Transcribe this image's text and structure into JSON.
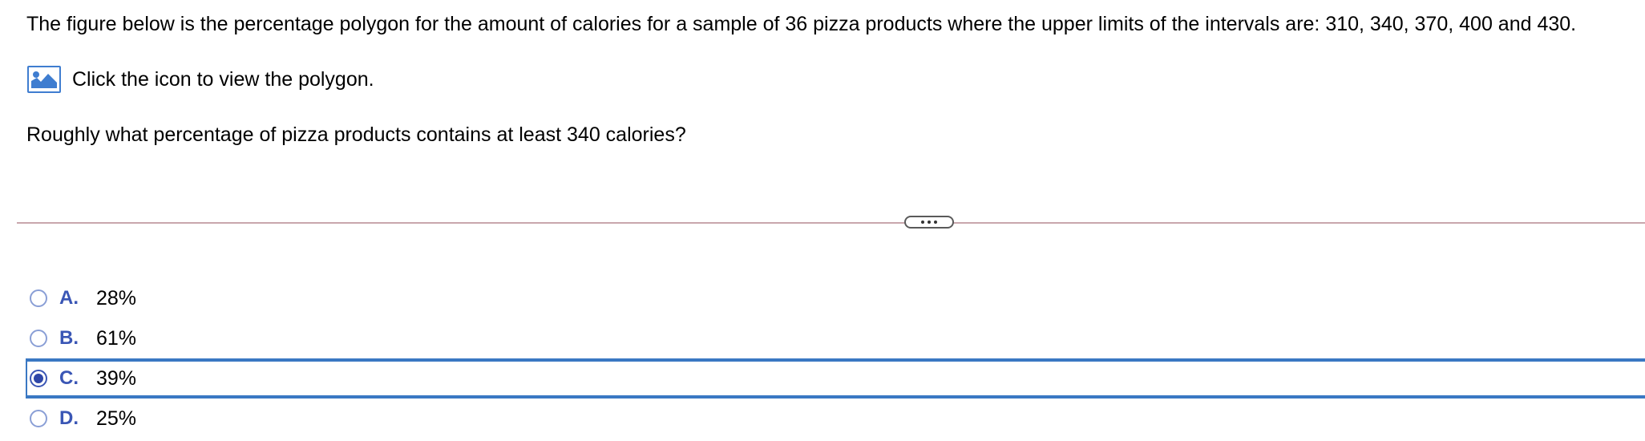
{
  "question": {
    "text": "The figure below is the percentage polygon for the amount of calories for a sample of 36 pizza products where the upper limits of the intervals are: 310, 340, 370, 400 and 430."
  },
  "figure_link": {
    "icon": "image-icon",
    "text": "Click the icon to view the polygon."
  },
  "prompt": {
    "text": "Roughly what percentage of pizza products contains at least 340 calories?"
  },
  "divider": {
    "handle_icon": "ellipsis-icon"
  },
  "options": [
    {
      "letter": "A.",
      "value": "28%",
      "selected": false
    },
    {
      "letter": "B.",
      "value": "61%",
      "selected": false
    },
    {
      "letter": "C.",
      "value": "39%",
      "selected": true
    },
    {
      "letter": "D.",
      "value": "25%",
      "selected": false
    }
  ],
  "colors": {
    "accent": "#3a78c3",
    "option_letter": "#3a56b5",
    "radio_border": "#8a9fd6",
    "divider": "#c9a7ad"
  }
}
